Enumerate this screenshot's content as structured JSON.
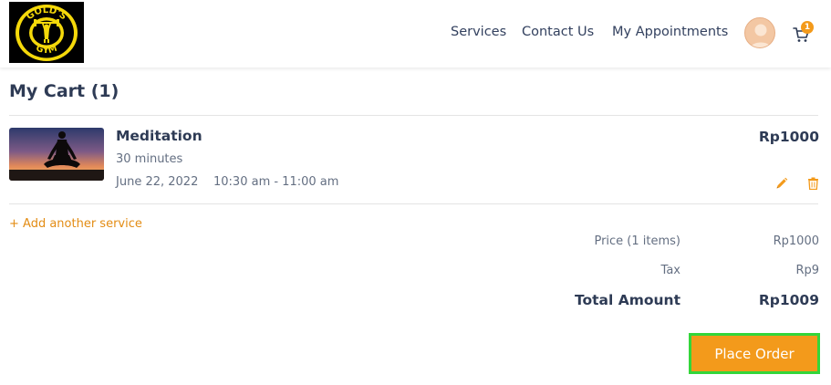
{
  "header": {
    "logo_text_top": "GOLD'S",
    "logo_text_bottom": "GYM",
    "nav": {
      "services": "Services",
      "contact": "Contact Us",
      "appointments": "My Appointments"
    },
    "cart_count": "1"
  },
  "cart": {
    "title": "My Cart (1)",
    "items": [
      {
        "name": "Meditation",
        "duration": "30 minutes",
        "date": "June 22, 2022",
        "time": "10:30 am - 11:00 am",
        "price": "Rp1000"
      }
    ],
    "add_service_label": "+ Add another service"
  },
  "summary": {
    "price_label": "Price (1 items)",
    "price_value": "Rp1000",
    "tax_label": "Tax",
    "tax_value": "Rp9",
    "total_label": "Total Amount",
    "total_value": "Rp1009"
  },
  "actions": {
    "place_order": "Place Order"
  },
  "colors": {
    "accent": "#f39a1b",
    "heading": "#2e3b55",
    "highlight": "#33d63a"
  },
  "icons": [
    "logo",
    "avatar-icon",
    "cart-icon",
    "edit-icon",
    "delete-icon"
  ]
}
